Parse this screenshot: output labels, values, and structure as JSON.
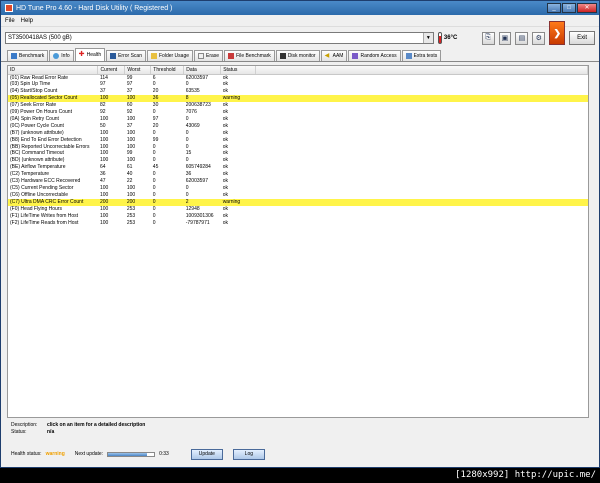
{
  "window": {
    "title": "HD Tune Pro 4.60 - Hard Disk Utility ( Registered )"
  },
  "menu": [
    "File",
    "Help"
  ],
  "toolbar": {
    "drive": "ST3500418AS (500 gB)",
    "temperature": "36°C",
    "exit_label": "Exit"
  },
  "tabs": [
    {
      "label": "Benchmark"
    },
    {
      "label": "Info"
    },
    {
      "label": "Health"
    },
    {
      "label": "Error Scan"
    },
    {
      "label": "Folder Usage"
    },
    {
      "label": "Erase"
    },
    {
      "label": "File Benchmark"
    },
    {
      "label": "Disk monitor"
    },
    {
      "label": "AAM"
    },
    {
      "label": "Random Access"
    },
    {
      "label": "Extra tests"
    }
  ],
  "active_tab": "Health",
  "table": {
    "headers": [
      "ID",
      "Current",
      "Worst",
      "Threshold",
      "Data",
      "Status"
    ],
    "rows": [
      [
        "(01) Raw Read Error Rate",
        "114",
        "99",
        "6",
        "62003597",
        "ok"
      ],
      [
        "(03) Spin Up Time",
        "97",
        "97",
        "0",
        "0",
        "ok"
      ],
      [
        "(04) Start/Stop Count",
        "37",
        "37",
        "20",
        "63535",
        "ok"
      ],
      [
        "(05) Reallocated Sector Count",
        "100",
        "100",
        "36",
        "8",
        "warning"
      ],
      [
        "(07) Seek Error Rate",
        "82",
        "60",
        "30",
        "200638723",
        "ok"
      ],
      [
        "(09) Power On Hours Count",
        "92",
        "92",
        "0",
        "7076",
        "ok"
      ],
      [
        "(0A) Spin Retry Count",
        "100",
        "100",
        "97",
        "0",
        "ok"
      ],
      [
        "(0C) Power Cycle Count",
        "50",
        "37",
        "20",
        "43069",
        "ok"
      ],
      [
        "(B7) (unknown attribute)",
        "100",
        "100",
        "0",
        "0",
        "ok"
      ],
      [
        "(B8) End To End Error Detection",
        "100",
        "100",
        "99",
        "0",
        "ok"
      ],
      [
        "(BB) Reported Uncorrectable Errors",
        "100",
        "100",
        "0",
        "0",
        "ok"
      ],
      [
        "(BC) Command Timeout",
        "100",
        "99",
        "0",
        "15",
        "ok"
      ],
      [
        "(BD) (unknown attribute)",
        "100",
        "100",
        "0",
        "0",
        "ok"
      ],
      [
        "(BE) Airflow Temperature",
        "64",
        "61",
        "45",
        "605749284",
        "ok"
      ],
      [
        "(C2) Temperature",
        "36",
        "40",
        "0",
        "36",
        "ok"
      ],
      [
        "(C3) Hardware ECC Recovered",
        "47",
        "22",
        "0",
        "62003597",
        "ok"
      ],
      [
        "(C5) Current Pending Sector",
        "100",
        "100",
        "0",
        "0",
        "ok"
      ],
      [
        "(C6) Offline Uncorrectable",
        "100",
        "100",
        "0",
        "0",
        "ok"
      ],
      [
        "(C7) Ultra DMA CRC Error Count",
        "200",
        "200",
        "0",
        "2",
        "warning"
      ],
      [
        "(F0) Head Flying Hours",
        "100",
        "253",
        "0",
        "12948",
        "ok"
      ],
      [
        "(F1) LifeTime Writes from Host",
        "100",
        "253",
        "0",
        "1009301306",
        "ok"
      ],
      [
        "(F2) LifeTime Reads from Host",
        "100",
        "253",
        "0",
        "-79787971",
        "ok"
      ]
    ]
  },
  "description": {
    "label": "Description:",
    "value": "click on an item for a detailed description"
  },
  "status": {
    "label": "Status:",
    "value": "n/a"
  },
  "footer": {
    "health_label": "Health status:",
    "health_value": "warning",
    "next_update_label": "Next update:",
    "timer": "0:33",
    "progress": 0.85,
    "update_label": "Update",
    "log_label": "Log"
  },
  "caption": "[1280x992] http://upic.me/"
}
